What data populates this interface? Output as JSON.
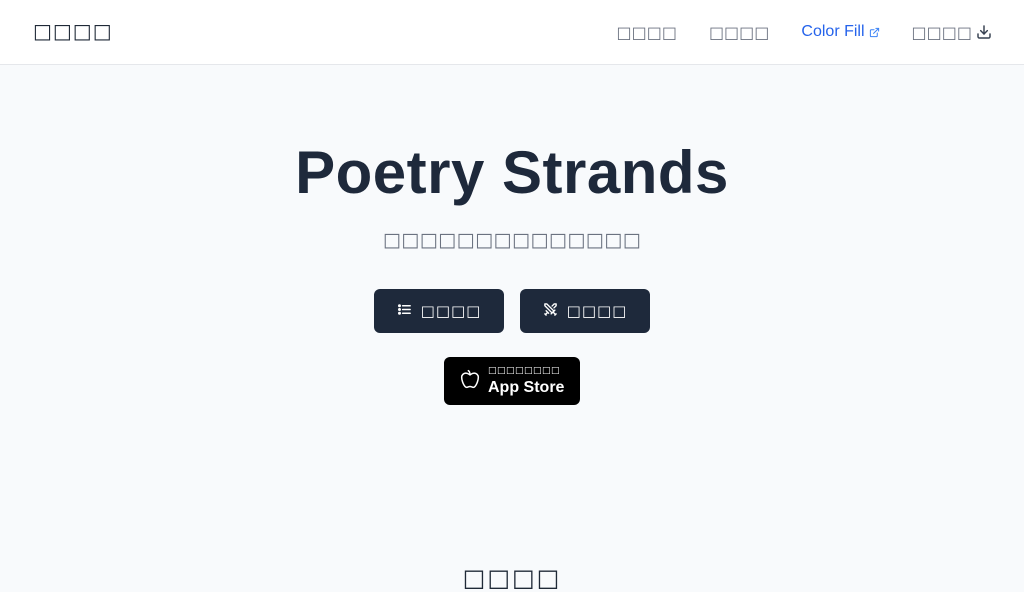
{
  "header": {
    "brand": "□□□□",
    "nav": [
      {
        "label": "□□□□"
      },
      {
        "label": "□□□□"
      },
      {
        "label": "Color Fill",
        "icon": "external-link-icon"
      },
      {
        "label": "□□□□",
        "icon": "download-icon"
      }
    ]
  },
  "hero": {
    "title": "Poetry Strands",
    "subtitle": "□□□□□□□□□□□□□□",
    "buttons": [
      {
        "label": "□□□□",
        "icon": "list-icon"
      },
      {
        "label": "□□□□",
        "icon": "swords-icon"
      }
    ],
    "app_store": {
      "small_label": "□□□□□□□□",
      "big_label": "App Store",
      "icon": "apple-icon"
    }
  },
  "section": {
    "heading": "□□□□"
  },
  "colors": {
    "accent": "#2563eb",
    "dark": "#1e293b",
    "muted": "#6b7280",
    "background": "#f8fafc"
  }
}
